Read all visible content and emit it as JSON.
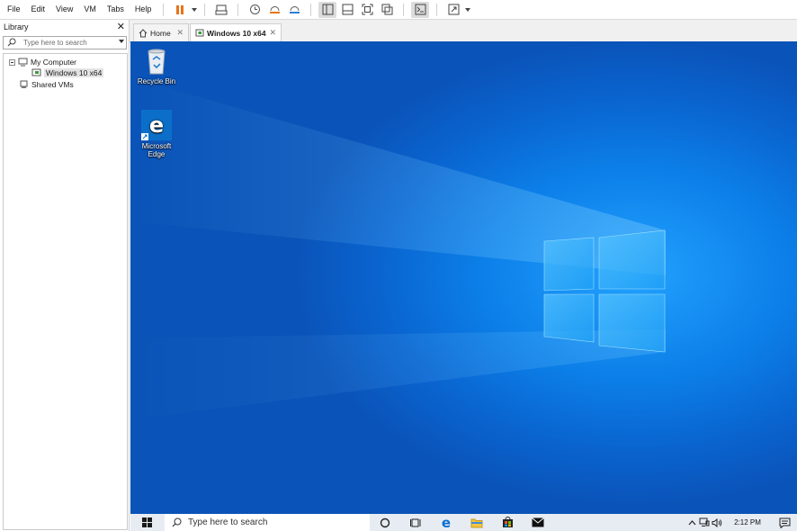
{
  "menu": [
    "File",
    "Edit",
    "View",
    "VM",
    "Tabs",
    "Help"
  ],
  "toolbar": {
    "icons": [
      "pause-icon",
      "send-ctrl-alt-del-icon",
      "snapshot-icon",
      "revert-snapshot-icon",
      "snapshot-manager-icon",
      "library-view-icon",
      "thumbnail-bar-icon",
      "full-screen-icon",
      "unity-icon",
      "console-view-icon",
      "stretch-guest-icon"
    ],
    "pause_color": "#e8731a"
  },
  "library": {
    "title": "Library",
    "close": "✕",
    "search_placeholder": "Type here to search",
    "tree": [
      {
        "label": "My Computer",
        "level": 0,
        "expanded": true
      },
      {
        "label": "Windows 10 x64",
        "level": 1,
        "selected": true
      },
      {
        "label": "Shared VMs",
        "level": 0
      }
    ]
  },
  "tabs": [
    {
      "label": "Home",
      "active": false,
      "close": "✕"
    },
    {
      "label": "Windows 10 x64",
      "active": true,
      "close": "✕"
    }
  ],
  "desktop": {
    "icons": [
      {
        "label": "Recycle Bin"
      },
      {
        "label_lines": [
          "Microsoft",
          "Edge"
        ]
      }
    ]
  },
  "taskbar": {
    "search_placeholder": "Type here to search",
    "clock_time": "2:12 PM",
    "accent": "#0078d7"
  }
}
